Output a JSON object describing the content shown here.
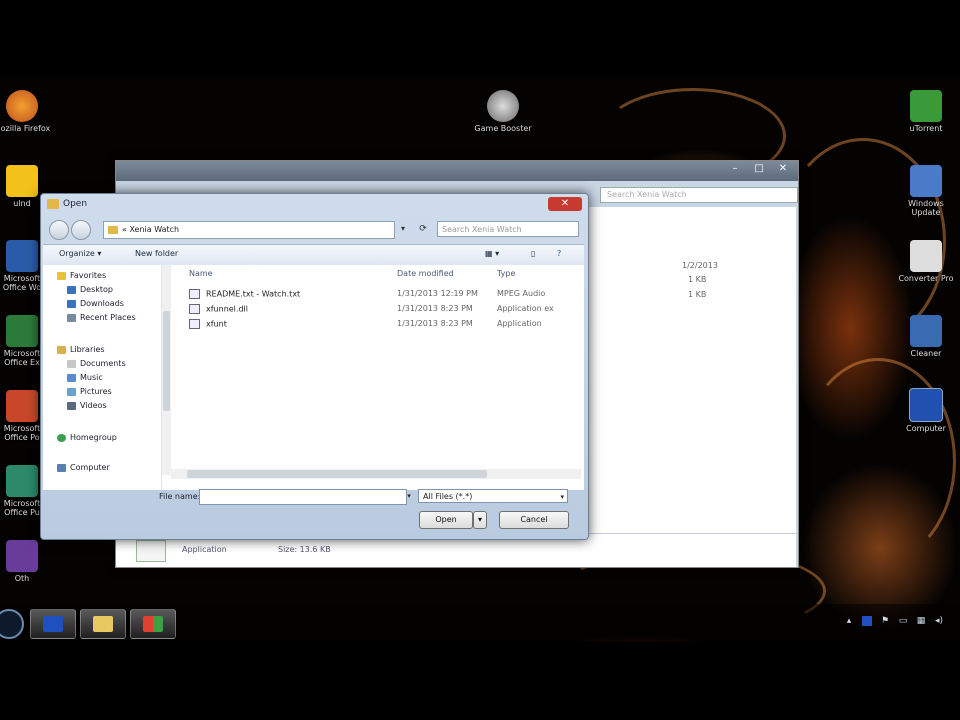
{
  "desktop": {
    "icons_left": [
      {
        "name": "Mozilla Firefox",
        "icon": "firefox-icon",
        "color": "#e07b20"
      },
      {
        "name": "ulnd",
        "icon": "aim-icon",
        "color": "#f2c21a"
      },
      {
        "name": "Microsoft Office Wo",
        "icon": "word-icon",
        "color": "#2a5ba8"
      },
      {
        "name": "Microsoft Office Ex",
        "icon": "excel-icon",
        "color": "#2c7a3a"
      },
      {
        "name": "Microsoft Office Po",
        "icon": "powerpoint-icon",
        "color": "#c8472b"
      },
      {
        "name": "Microsoft Office Pu",
        "icon": "publisher-icon",
        "color": "#2c8a6a"
      },
      {
        "name": "Oth",
        "icon": "app-icon",
        "color": "#6a3c9a"
      }
    ],
    "icons_top": [
      {
        "name": "Game Booster",
        "icon": "game-booster-icon",
        "color": "#8a8a8a"
      }
    ],
    "icons_right": [
      {
        "name": "uTorrent",
        "icon": "utorrent-icon",
        "color": "#3a9a3a"
      },
      {
        "name": "Windows Update",
        "icon": "windows-update-icon",
        "color": "#4a7ac8"
      },
      {
        "name": "Converter Pro",
        "icon": "converter-icon",
        "color": "#dddddd"
      },
      {
        "name": "Cleaner",
        "icon": "cleaner-icon",
        "color": "#3a6ab0"
      },
      {
        "name": "Computer",
        "icon": "computer-icon",
        "color": "#2050b0"
      }
    ]
  },
  "background_window": {
    "search_placeholder": "Search Xenia Watch",
    "rows": [
      {
        "date": "1/2/2013",
        "size": "1 KB"
      },
      {
        "date": "",
        "size": "1 KB"
      },
      {
        "date": "",
        "size": "1 KB"
      }
    ],
    "details_type": "Application",
    "details_size": "Size: 13.6 KB"
  },
  "dialog": {
    "title": "Open",
    "close_label": "✕",
    "address": "« Xenia Watch",
    "search_placeholder": "Search Xenia Watch",
    "toolbar": {
      "organize": "Organize ▾",
      "new_folder": "New folder"
    },
    "columns": {
      "name": "Name",
      "date": "Date modified",
      "type": "Type"
    },
    "nav": {
      "favorites": "Favorites",
      "desktop": "Desktop",
      "downloads": "Downloads",
      "recent": "Recent Places",
      "libraries": "Libraries",
      "documents": "Documents",
      "music": "Music",
      "pictures": "Pictures",
      "videos": "Videos",
      "homegroup": "Homegroup",
      "computer": "Computer"
    },
    "files": [
      {
        "name": "README.txt - Watch.txt",
        "date": "1/31/2013 12:19 PM",
        "type": "MPEG Audio"
      },
      {
        "name": "xfunnel.dll",
        "date": "1/31/2013 8:23 PM",
        "type": "Application ex"
      },
      {
        "name": "xfunt",
        "date": "1/31/2013 8:23 PM",
        "type": "Application"
      }
    ],
    "file_name_label": "File name:",
    "file_name_value": "",
    "filter": "All Files (*.*)",
    "open_button": "Open",
    "cancel_button": "Cancel"
  },
  "taskbar": {
    "items": [
      "Start",
      "Photoshop",
      "Explorer",
      "Windows"
    ]
  }
}
